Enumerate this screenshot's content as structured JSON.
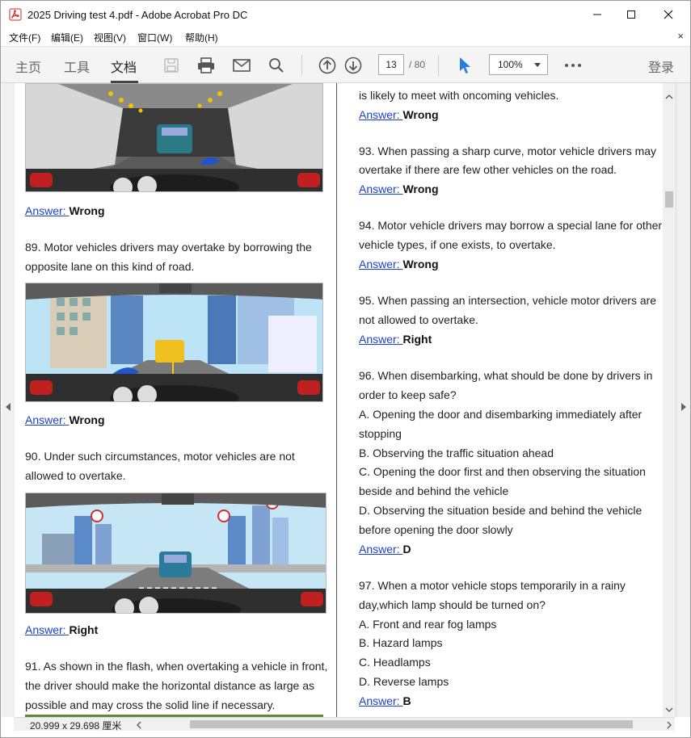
{
  "window": {
    "title": "2025 Driving test 4.pdf - Adobe Acrobat Pro DC"
  },
  "menu": {
    "file": "文件(F)",
    "edit": "编辑(E)",
    "view": "视图(V)",
    "window": "窗口(W)",
    "help": "帮助(H)",
    "close_doc": "×"
  },
  "toolbar": {
    "tab_home": "主页",
    "tab_tools": "工具",
    "tab_document": "文档",
    "page_current": "13",
    "page_total": "/ 80",
    "zoom": "100%",
    "login": "登录"
  },
  "document": {
    "left": {
      "q88_answer_link": "Answer: ",
      "q88_answer_value": "Wrong",
      "q89_line1": "89. Motor vehicles drivers may overtake by borrowing the",
      "q89_line2": "opposite lane on this kind of road.",
      "q89_answer_link": "Answer: ",
      "q89_answer_value": "Wrong",
      "q90_line1": "90. Under such circumstances, motor vehicles are not",
      "q90_line2": "allowed to overtake.",
      "q90_answer_link": "Answer: ",
      "q90_answer_value": "Right",
      "q91_line1": "91. As shown in the flash, when overtaking a vehicle in front,",
      "q91_line2": "the driver should make the horizontal distance as large as",
      "q91_line3": "possible and may cross the solid line if necessary."
    },
    "right": {
      "q92_tail": "is likely to meet with oncoming vehicles.",
      "q92_answer_link": "Answer: ",
      "q92_answer_value": "Wrong",
      "q93_line1": "93. When passing a sharp curve, motor vehicle drivers may",
      "q93_line2": "overtake if there are few other vehicles on the road.",
      "q93_answer_link": "Answer: ",
      "q93_answer_value": "Wrong",
      "q94_line1": "94. Motor vehicle drivers may borrow a special lane for other",
      "q94_line2": "vehicle types, if one exists, to overtake.",
      "q94_answer_link": "Answer: ",
      "q94_answer_value": "Wrong",
      "q95_line1": "95. When passing an intersection, vehicle motor drivers are",
      "q95_line2": "not allowed to overtake.",
      "q95_answer_link": "Answer: ",
      "q95_answer_value": "Right",
      "q96_line1": "96. When disembarking, what should be done by drivers in",
      "q96_line2": "order to keep safe?",
      "q96_a1": "A. Opening the door and disembarking immediately after",
      "q96_a2": "stopping",
      "q96_b": "B. Observing the traffic situation ahead",
      "q96_c1": "C. Opening the door first and then observing the situation",
      "q96_c2": "beside and behind the vehicle",
      "q96_d1": "D. Observing the situation beside and behind the vehicle",
      "q96_d2": "before opening the door slowly",
      "q96_answer_link": "Answer: ",
      "q96_answer_value": "D",
      "q97_line1": "97. When a motor vehicle stops temporarily in a rainy",
      "q97_line2": "day,which lamp should be turned on?",
      "q97_a": "A. Front and rear fog lamps",
      "q97_b": "B. Hazard lamps",
      "q97_c": "C. Headlamps",
      "q97_d": "D. Reverse lamps",
      "q97_answer_link": "Answer: ",
      "q97_answer_value": "B"
    }
  },
  "status": {
    "page_size": "20.999 x 29.698 厘米"
  }
}
